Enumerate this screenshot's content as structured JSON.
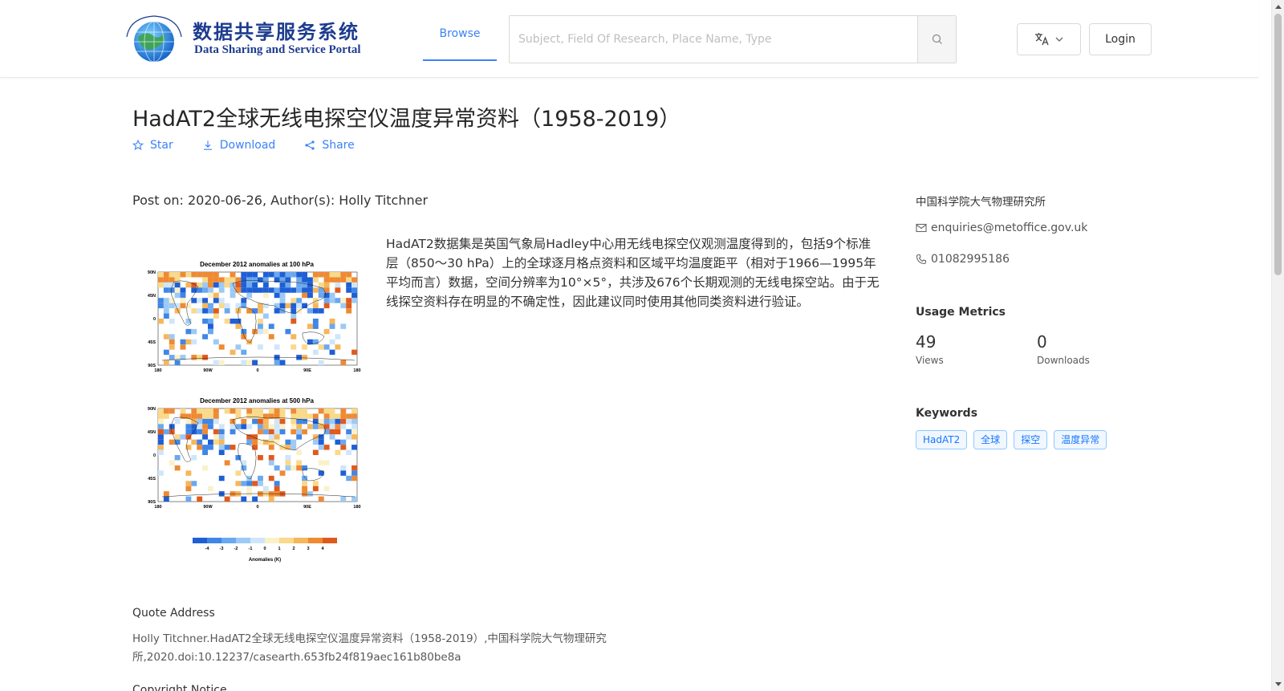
{
  "header": {
    "logo_cn": "数据共享服务系统",
    "logo_en": "Data Sharing and Service Portal",
    "nav_browse": "Browse",
    "search_placeholder": "Subject, Field Of Research, Place Name, Type",
    "login_label": "Login"
  },
  "dataset": {
    "title": "HadAT2全球无线电探空仪温度异常资料（1958-2019）",
    "actions": {
      "star": "Star",
      "download": "Download",
      "share": "Share"
    },
    "post_info": "Post on: 2020-06-26, Author(s): Holly Titchner",
    "description": "HadAT2数据集是英国气象局Hadley中心用无线电探空仪观测温度得到的，包括9个标准层（850～30 hPa）上的全球逐月格点资料和区域平均温度距平（相对于1966—1995年平均而言）数据，空间分辨率为10°×5°，共涉及676个长期观测的无线电探空站。由于无线探空资料存在明显的不确定性，因此建议同时使用其他同类资料进行验证。",
    "figure": {
      "map1_title": "December 2012 anomalies at 100 hPa",
      "map2_title": "December 2012 anomalies at 500 hPa",
      "lat_ticks": [
        "90N",
        "45N",
        "0",
        "45S",
        "90S"
      ],
      "lon_ticks": [
        "180",
        "90W",
        "0",
        "90E",
        "180"
      ],
      "colorbar_ticks": [
        "-4",
        "-3",
        "-2",
        "-1",
        "0",
        "1",
        "2",
        "3",
        "4"
      ],
      "colorbar_label": "Anomalies (K)",
      "colorbar_colors": [
        "#1e5fd6",
        "#3f86e6",
        "#6aa8ef",
        "#9ccaf5",
        "#cfe6fa",
        "#fbf1c9",
        "#f9d98a",
        "#f6b65a",
        "#ef8a33",
        "#e05a1e"
      ]
    },
    "quote_heading": "Quote Address",
    "quote_text": "Holly Titchner.HadAT2全球无线电探空仪温度异常资料（1958-2019）,中国科学院大气物理研究所,2020.doi:10.12237/casearth.653fb24f819aec161b80be8a",
    "copyright_heading": "Copyright Notice"
  },
  "sidebar": {
    "organization": "中国科学院大气物理研究所",
    "email": "enquiries@metoffice.gov.uk",
    "phone": "01082995186",
    "metrics_heading": "Usage Metrics",
    "views_value": "49",
    "views_label": "Views",
    "downloads_value": "0",
    "downloads_label": "Downloads",
    "keywords_heading": "Keywords",
    "keywords": [
      "HadAT2",
      "全球",
      "探空",
      "温度异常"
    ]
  },
  "colors": {
    "accent": "#3b82f6",
    "logo_blue": "#1d3c8f",
    "tag_border": "#91caff"
  }
}
